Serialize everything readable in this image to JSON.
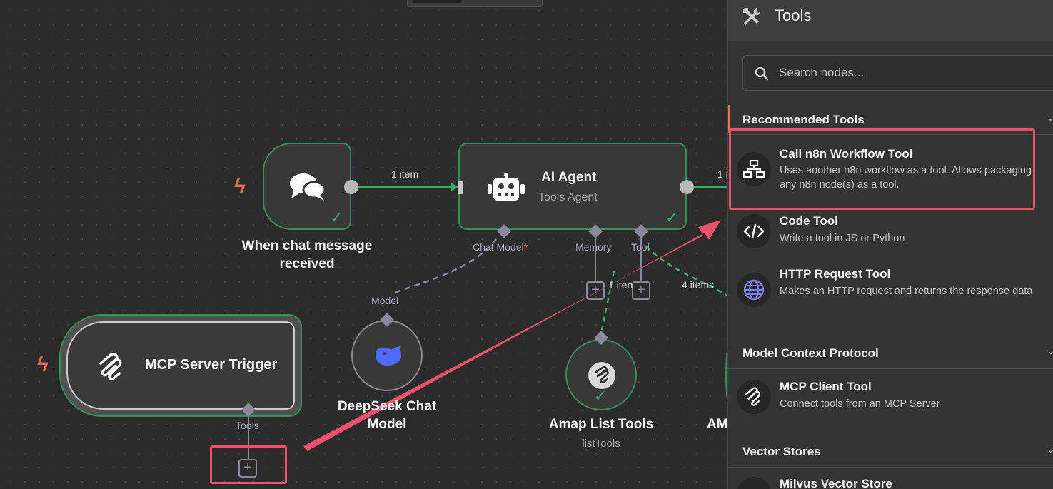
{
  "canvas": {
    "nodes": {
      "chat_trigger": {
        "label": "When chat message received"
      },
      "ai_agent": {
        "label": "AI Agent",
        "subtitle": "Tools Agent",
        "ports": {
          "chat_model": "Chat Model",
          "chat_model_required": "*",
          "memory": "Memory",
          "tool": "Tool"
        }
      },
      "mcp_trigger": {
        "label": "MCP Server Trigger",
        "port": "Tools"
      },
      "deepseek": {
        "label": "DeepSeek Chat Model",
        "port": "Model"
      },
      "amap_list": {
        "label": "Amap List Tools",
        "subtitle": "listTools"
      },
      "partial_node": {
        "label": "AM"
      }
    },
    "edges": {
      "chat_to_agent": "1 item",
      "agent_out": "1 i",
      "memory_items": "1 iten",
      "tool_items": "4 items"
    },
    "plus_symbol": "+"
  },
  "panel": {
    "title": "Tools",
    "search": {
      "placeholder": "Search nodes..."
    },
    "sections": [
      {
        "title": "Recommended Tools",
        "items": [
          {
            "name": "Call n8n Workflow Tool",
            "description": "Uses another n8n workflow as a tool. Allows packaging any n8n node(s) as a tool.",
            "icon": "sitemap-icon"
          },
          {
            "name": "Code Tool",
            "description": "Write a tool in JS or Python",
            "icon": "code-icon"
          },
          {
            "name": "HTTP Request Tool",
            "description": "Makes an HTTP request and returns the response data",
            "icon": "globe-icon"
          }
        ]
      },
      {
        "title": "Model Context Protocol",
        "items": [
          {
            "name": "MCP Client Tool",
            "description": "Connect tools from an MCP Server",
            "icon": "mcp-icon"
          }
        ]
      },
      {
        "title": "Vector Stores",
        "items": [
          {
            "name": "Milvus Vector Store",
            "description": "",
            "icon": "milvus-icon"
          }
        ]
      }
    ]
  },
  "colors": {
    "success": "#3c8c5b",
    "accent": "#ff6d4a",
    "highlight": "#f0506e",
    "http_icon": "#7f7fff",
    "deepseek_blue": "#4d6bfe"
  }
}
